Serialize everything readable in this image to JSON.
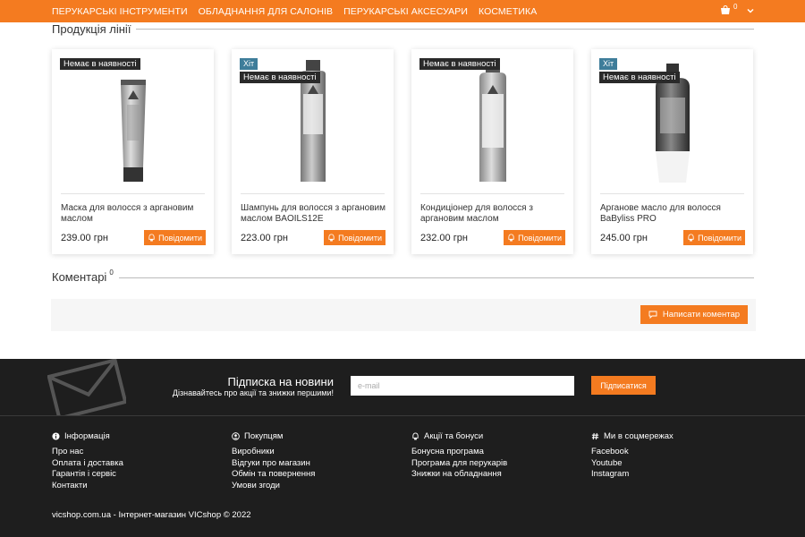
{
  "nav": {
    "items": [
      "ПЕРУКАРСЬКІ ІНСТРУМЕНТИ",
      "ОБЛАДНАННЯ ДЛЯ САЛОНІВ",
      "ПЕРУКАРСЬКІ АКСЕСУАРИ",
      "КОСМЕТИКА"
    ],
    "cart_count": "0",
    "cart_icon": "cart-icon",
    "menu_icon": "chevron-down-icon"
  },
  "products_section": {
    "title": "Продукція лінії"
  },
  "products": [
    {
      "hit": "",
      "availability": "Немає в наявності",
      "name": "Маска для волосся з аргановим маслом",
      "price": "239.00 грн",
      "notify": "Повідомити",
      "image": "tube-product"
    },
    {
      "hit": "Хіт",
      "availability": "Немає в наявності",
      "name": "Шампунь для волосся з аргановим маслом BAOILS12E",
      "price": "223.00 грн",
      "notify": "Повідомити",
      "image": "bottle-product"
    },
    {
      "hit": "",
      "availability": "Немає в наявності",
      "name": "Кондиціонер для волосся з аргановим маслом",
      "price": "232.00 грн",
      "notify": "Повідомити",
      "image": "bottle-product"
    },
    {
      "hit": "Хіт",
      "availability": "Немає в наявності",
      "name": "Арганове масло для волосся BaByliss PRO",
      "price": "245.00 грн",
      "notify": "Повідомити",
      "image": "oil-bottle-product"
    }
  ],
  "comments": {
    "title": "Коментарі",
    "count": "0",
    "write_button": "Написати коментар"
  },
  "subscribe": {
    "title": "Підписка на новини",
    "subtitle": "Дізнавайтесь про акції та знижки першими!",
    "placeholder": "e-mail",
    "button": "Підписатися"
  },
  "footer": {
    "columns": [
      {
        "heading": "Інформація",
        "icon": "info-icon",
        "links": [
          "Про нас",
          "Оплата і доставка",
          "Гарантія і сервіс",
          "Контакти"
        ]
      },
      {
        "heading": "Покупцям",
        "icon": "user-icon",
        "links": [
          "Виробники",
          "Відгуки про магазин",
          "Обмін та повернення",
          "Умови згоди"
        ]
      },
      {
        "heading": "Акції та бонуси",
        "icon": "bell-icon",
        "links": [
          "Бонусна програма",
          "Програма для перукарів",
          "Знижки на обладнання"
        ]
      },
      {
        "heading": "Ми в соцмережах",
        "icon": "hashtag-icon",
        "links": [
          "Facebook",
          "Youtube",
          "Instagram"
        ]
      }
    ],
    "copyright": "vicshop.com.ua - Інтернет-магазин VICshop © 2022"
  },
  "colors": {
    "accent": "#f47b20",
    "footer_bg": "#1e1e1e",
    "hit_badge": "#3e7d9a",
    "out_badge": "#2a2a2a"
  }
}
